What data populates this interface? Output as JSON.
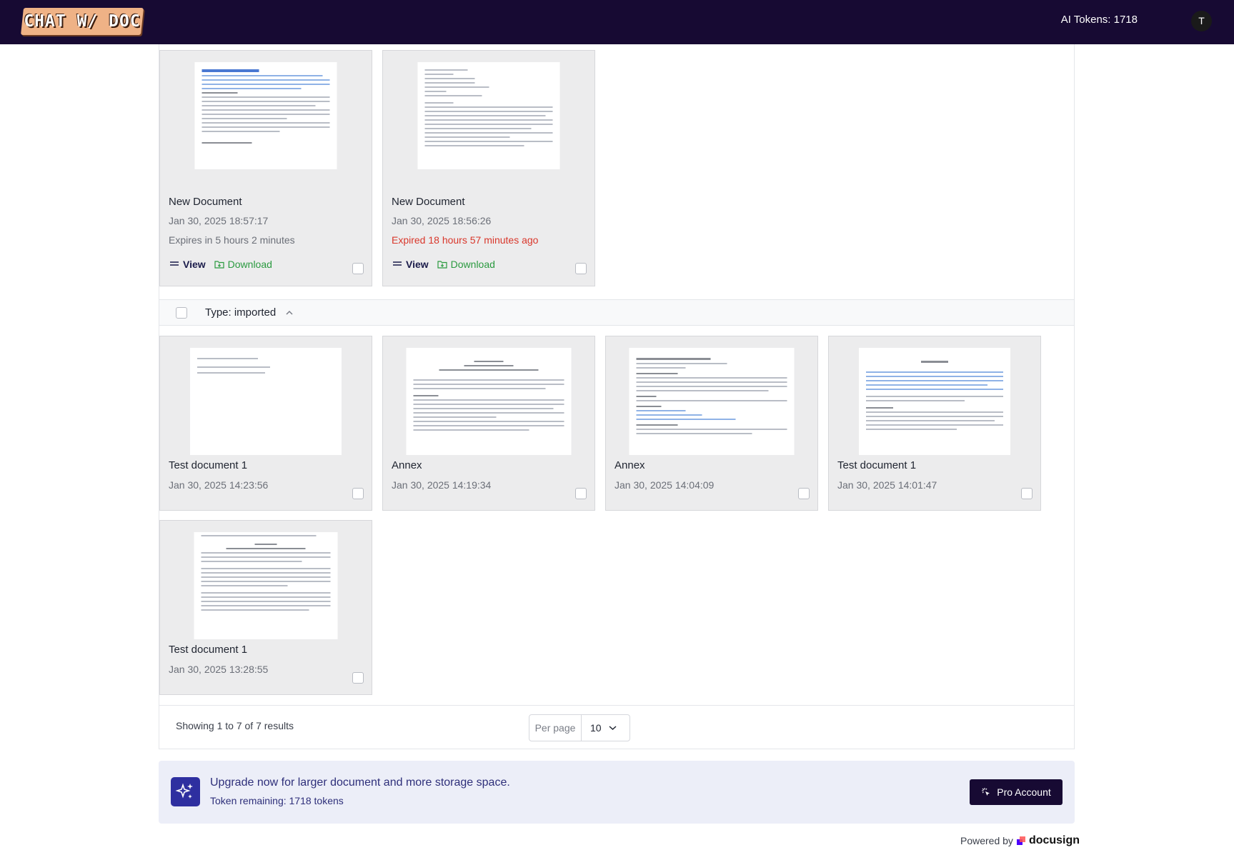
{
  "header": {
    "logo_text": "CHAT W/ DOC",
    "tokens_label": "AI Tokens: 1718",
    "avatar_initial": "T"
  },
  "generated_docs": [
    {
      "name": "New Document",
      "date": "Jan 30, 2025 18:57:17",
      "expiry": "Expires in 5 hours 2 minutes",
      "expired": false
    },
    {
      "name": "New Document",
      "date": "Jan 30, 2025 18:56:26",
      "expiry": "Expired 18 hours 57 minutes ago",
      "expired": true
    }
  ],
  "actions": {
    "view_label": "View",
    "download_label": "Download"
  },
  "imported_group": {
    "label": "Type: imported"
  },
  "imported_docs": [
    {
      "name": "Test document 1",
      "date": "Jan 30, 2025 14:23:56"
    },
    {
      "name": "Annex",
      "date": "Jan 30, 2025 14:19:34"
    },
    {
      "name": "Annex",
      "date": "Jan 30, 2025 14:04:09"
    },
    {
      "name": "Test document 1",
      "date": "Jan 30, 2025 14:01:47"
    },
    {
      "name": "Test document 1",
      "date": "Jan 30, 2025 13:28:55"
    }
  ],
  "pagination": {
    "results_text": "Showing 1 to 7 of 7 results",
    "per_page_label": "Per page",
    "per_page_value": "10"
  },
  "banner": {
    "title": "Upgrade now for larger document and more storage space.",
    "subtitle": "Token remaining: 1718 tokens",
    "button_label": "Pro Account"
  },
  "footer": {
    "powered_label": "Powered by",
    "brand": "docusign"
  },
  "colors": {
    "nav_bg": "#170a33",
    "logo_bg": "#efb286",
    "expired_red": "#d9372b",
    "download_green": "#2a9a3f",
    "banner_bg": "#eceef8"
  }
}
